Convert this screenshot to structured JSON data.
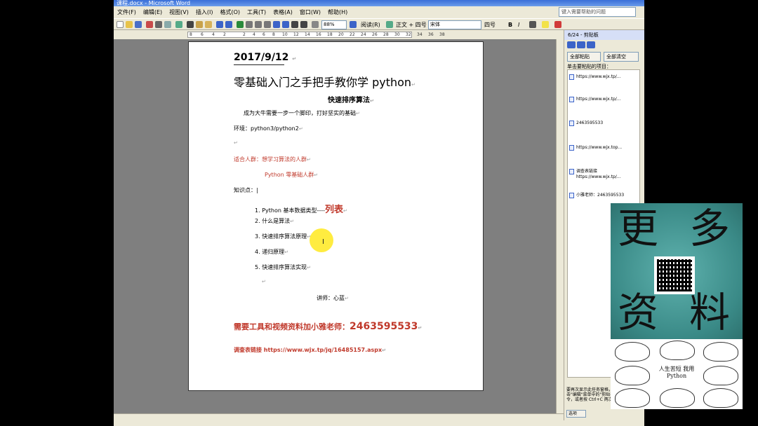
{
  "window": {
    "title": "课程.docx - Microsoft Word"
  },
  "menu": [
    "文件(F)",
    "编辑(E)",
    "视图(V)",
    "插入(I)",
    "格式(O)",
    "工具(T)",
    "表格(A)",
    "窗口(W)",
    "帮助(H)"
  ],
  "help_search": {
    "placeholder": "键入需要帮助的问题"
  },
  "toolbar": {
    "zoom": "88%",
    "read_button": "阅读(R)",
    "style": "正文 + 四号",
    "font": "宋体",
    "size": "四号",
    "bold": "B",
    "italic": "I"
  },
  "ruler": {
    "marks": [
      "8",
      "6",
      "4",
      "2",
      "2",
      "4",
      "6",
      "8",
      "10",
      "12",
      "14",
      "16",
      "18",
      "20",
      "22",
      "24",
      "26",
      "28",
      "30",
      "32",
      "34",
      "36",
      "38"
    ]
  },
  "document": {
    "date": "2017/9/12",
    "title": "零基础入门之手把手教你学 python",
    "subtitle": "快速排序算法",
    "intro": "成为大牛需要一步一个脚印，打好坚实的基础",
    "env": "环境：python3/python2",
    "audience1": "适合人群：想学习算法的人群",
    "audience2": "Python 零基础人群",
    "knowledge": "知识点：",
    "list": [
      {
        "num": "1.",
        "text": "Python 基本数据类型----",
        "highlight": "列表"
      },
      {
        "num": "2.",
        "text": "什么是算法"
      },
      {
        "num": "3.",
        "text": "快速排序算法原理"
      },
      {
        "num": "4.",
        "text": "递归原理"
      },
      {
        "num": "5.",
        "text": "快速排序算法实现"
      }
    ],
    "teacher": "讲师：心蓝",
    "contact": "需要工具和视频资料加小雅老师：",
    "contact_number": "2463595533",
    "survey": "调查表链接 https://www.wjx.tp/jq/16485157.aspx",
    "para_mark": "↵"
  },
  "clipboard": {
    "header": "6/24 - 剪贴板",
    "paste_all": "全部粘贴",
    "clear_all": "全部清空",
    "hint": "单击要粘贴的项目：",
    "items": [
      "https://www.wjx.tp/...",
      "https://www.wjx.tp/...",
      "2463595533",
      "https://www.wjx.top...",
      "调查表链接",
      "https://www.wjx.tp/...",
      "小雅老师：2463595533"
    ],
    "footer": "要再次显示此任务窗格，请单击\"编辑\"菜单中的\"剪贴板\"命令，或者按 Ctrl+C 两次。",
    "options": "选项"
  },
  "promo": {
    "chars": [
      "更",
      "多",
      "资",
      "料"
    ],
    "caption": "人生苦短 我用Python"
  },
  "colors": {
    "accent_red": "#c0392b",
    "promo_teal": "#3a8a87",
    "highlight_yellow": "#ffe600"
  }
}
